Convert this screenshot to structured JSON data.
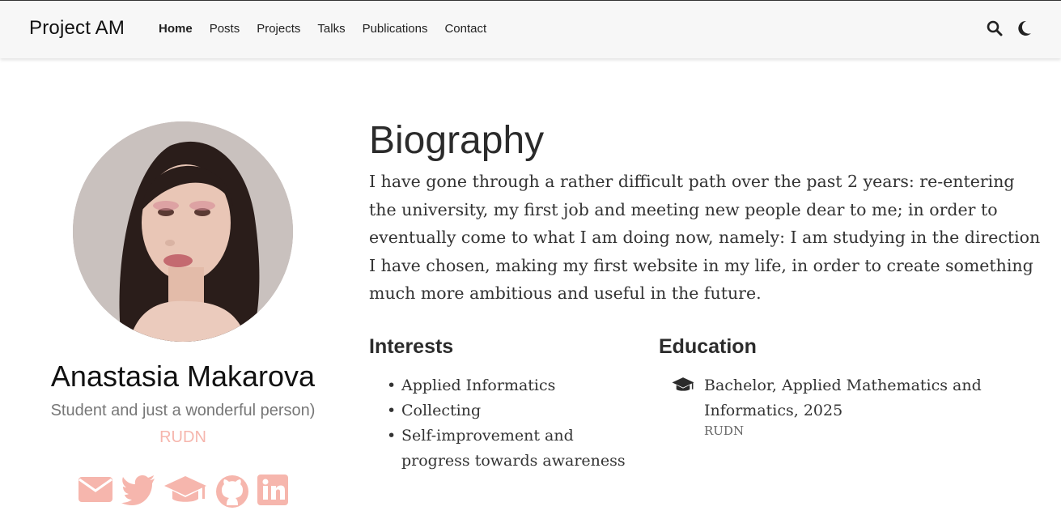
{
  "navbar": {
    "brand": "Project AM",
    "links": [
      {
        "label": "Home",
        "active": true
      },
      {
        "label": "Posts"
      },
      {
        "label": "Projects"
      },
      {
        "label": "Talks"
      },
      {
        "label": "Publications"
      },
      {
        "label": "Contact"
      }
    ],
    "icons": [
      "search-icon",
      "moon-icon"
    ]
  },
  "profile": {
    "name": "Anastasia Makarova",
    "role": "Student and just a wonderful person)",
    "organization": "RUDN",
    "accent_color": "#f6b6ad",
    "socials": [
      "envelope-icon",
      "twitter-icon",
      "graduation-cap-icon",
      "github-icon",
      "linkedin-icon"
    ]
  },
  "biography": {
    "title": "Biography",
    "text": "I have gone through a rather difficult path over the past 2 years: re-entering the university, my first job and meeting new people dear to me; in order to eventually come to what I am doing now, namely: I am studying in the direction I have chosen, making my first website in my life, in order to create something much more ambitious and useful in the future."
  },
  "interests": {
    "title": "Interests",
    "items": [
      "Applied Informatics",
      "Collecting",
      "Self-improvement and progress towards awareness"
    ]
  },
  "education": {
    "title": "Education",
    "items": [
      {
        "course": "Bachelor, Applied Mathematics and Informatics, 2025",
        "institution": "RUDN"
      }
    ]
  }
}
